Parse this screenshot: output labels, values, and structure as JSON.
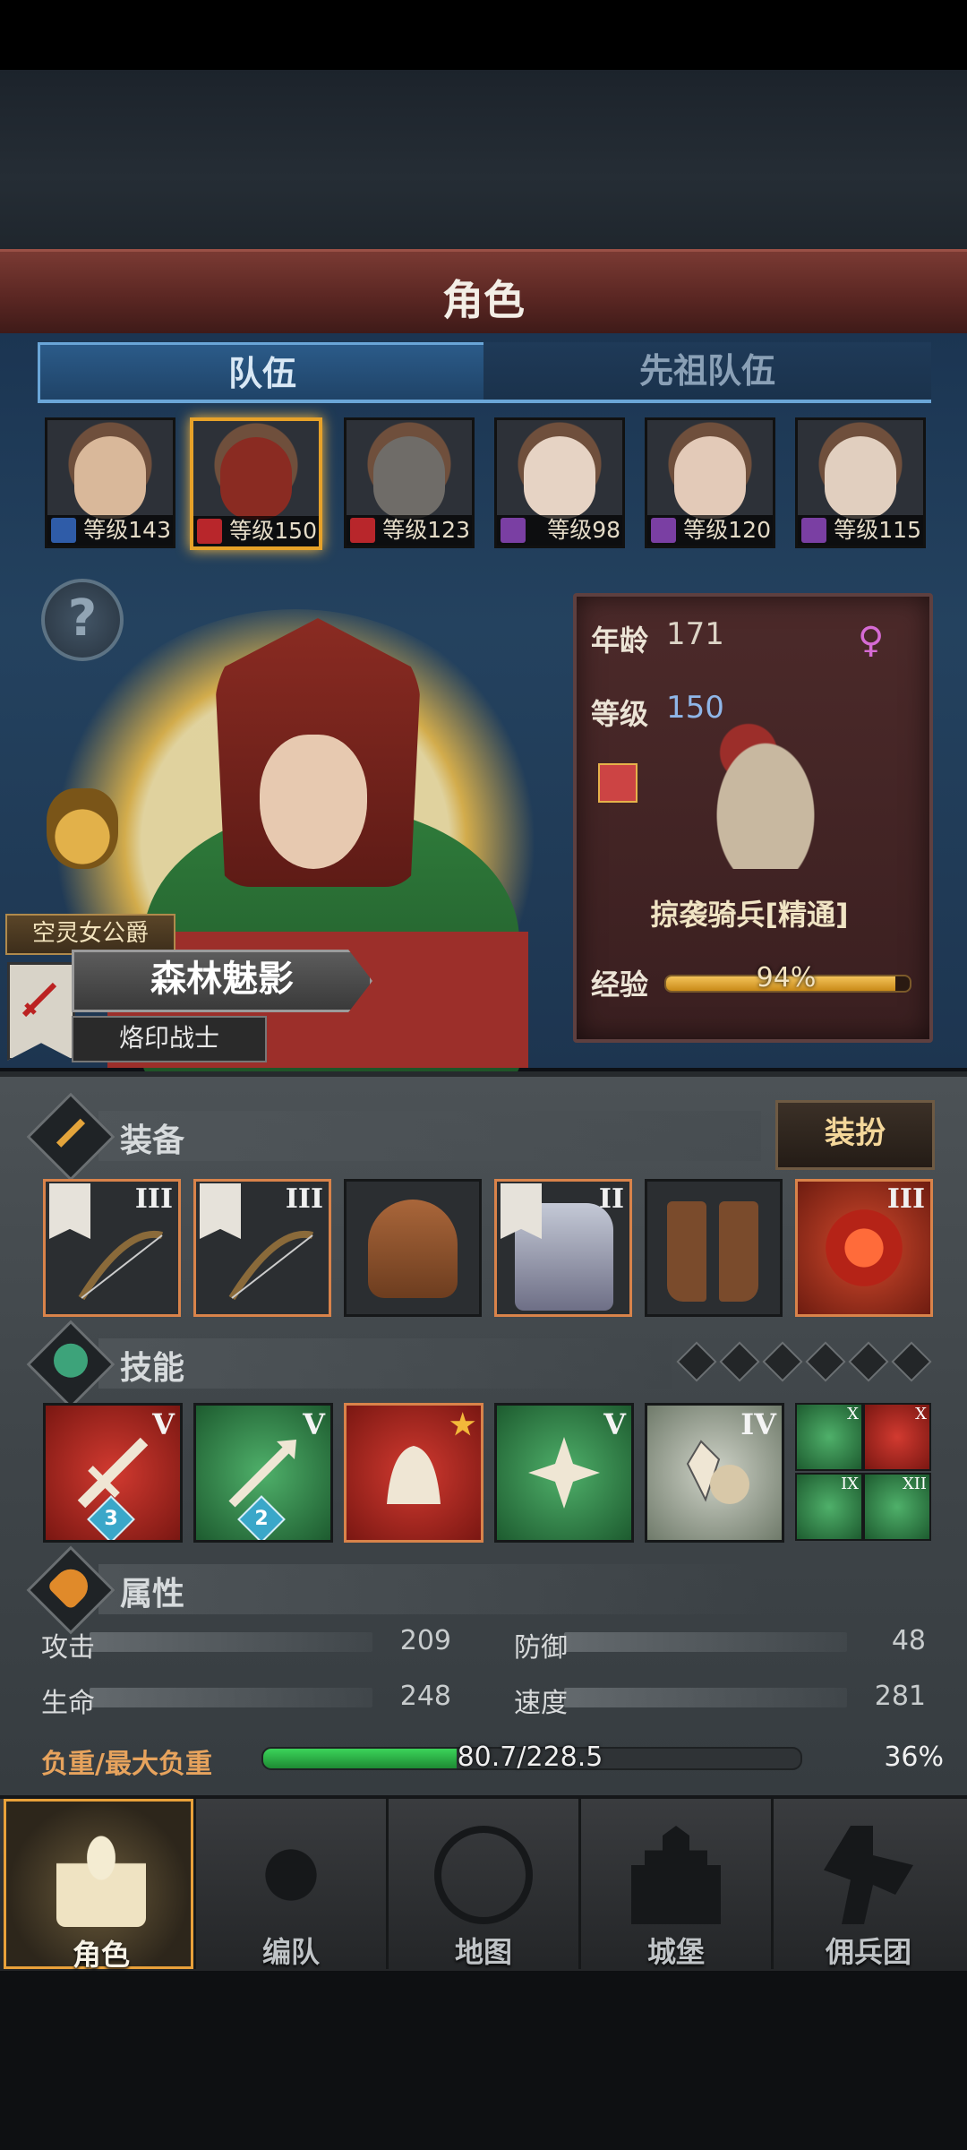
{
  "header": {
    "title": "角色"
  },
  "tabs": [
    {
      "label": "队伍",
      "active": true
    },
    {
      "label": "先祖队伍",
      "active": false
    }
  ],
  "roster": [
    {
      "level_text": "等级143",
      "class_icon": "spear-icon",
      "class_color": "#2f5ca8",
      "selected": false
    },
    {
      "level_text": "等级150",
      "class_icon": "horse-icon",
      "class_color": "#b8262b",
      "selected": true
    },
    {
      "level_text": "等级123",
      "class_icon": "horse-icon",
      "class_color": "#b8262b",
      "selected": false
    },
    {
      "level_text": "等级98",
      "class_icon": "staff-icon",
      "class_color": "#7a3fa3",
      "selected": false
    },
    {
      "level_text": "等级120",
      "class_icon": "staff-icon",
      "class_color": "#7a3fa3",
      "selected": false
    },
    {
      "level_text": "等级115",
      "class_icon": "staff-icon",
      "class_color": "#7a3fa3",
      "selected": false
    }
  ],
  "hero": {
    "title": "空灵女公爵",
    "name": "森林魅影",
    "class": "烙印战士"
  },
  "info": {
    "age_label": "年龄",
    "age": "171",
    "level_label": "等级",
    "level": "150",
    "gender_icon": "female-icon",
    "mount_name": "掠袭骑兵[精通]",
    "exp_label": "经验",
    "exp_pct_text": "94%",
    "exp_fraction": 0.94
  },
  "equipment": {
    "label": "装备",
    "dress_button": "装扮",
    "slots": [
      {
        "name": "bow-slot-1",
        "tier": "III",
        "has_flag": true,
        "orange": true
      },
      {
        "name": "bow-slot-2",
        "tier": "III",
        "has_flag": true,
        "orange": true
      },
      {
        "name": "helmet-slot",
        "tier": "",
        "has_flag": false,
        "orange": false
      },
      {
        "name": "armor-slot",
        "tier": "II",
        "has_flag": true,
        "orange": true
      },
      {
        "name": "boots-slot",
        "tier": "",
        "has_flag": false,
        "orange": false
      },
      {
        "name": "emblem-slot",
        "tier": "III",
        "has_flag": false,
        "orange": true
      }
    ]
  },
  "skills": {
    "label": "技能",
    "slots": 6,
    "list": [
      {
        "color": "red",
        "tier": "V",
        "badge": "3"
      },
      {
        "color": "green",
        "tier": "V",
        "badge": "2"
      },
      {
        "color": "red",
        "tier": "★",
        "badge": ""
      },
      {
        "color": "green",
        "tier": "V",
        "badge": ""
      },
      {
        "color": "green",
        "tier": "IV",
        "badge": ""
      }
    ],
    "mini": [
      {
        "color": "green",
        "tier": "X"
      },
      {
        "color": "red",
        "tier": "X"
      },
      {
        "color": "green",
        "tier": "IX"
      },
      {
        "color": "green",
        "tier": "XII"
      }
    ]
  },
  "attributes": {
    "label": "属性",
    "stats": [
      {
        "label": "攻击",
        "value": "209"
      },
      {
        "label": "防御",
        "value": "48"
      },
      {
        "label": "生命",
        "value": "248"
      },
      {
        "label": "速度",
        "value": "281"
      }
    ],
    "weight_label": "负重/最大负重",
    "weight_text": "80.7/228.5",
    "weight_pct_text": "36%",
    "weight_fraction": 0.36
  },
  "nav": [
    {
      "label": "角色",
      "icon": "knight-icon",
      "active": true
    },
    {
      "label": "编队",
      "icon": "helmet-icon",
      "active": false
    },
    {
      "label": "地图",
      "icon": "compass-icon",
      "active": false
    },
    {
      "label": "城堡",
      "icon": "castle-icon",
      "active": false
    },
    {
      "label": "佣兵团",
      "icon": "mercenary-icon",
      "active": false
    }
  ],
  "colors": {
    "accent_gold": "#e9a13a",
    "tab_blue": "#6aa6d8",
    "weight_green": "#2fb84a"
  }
}
